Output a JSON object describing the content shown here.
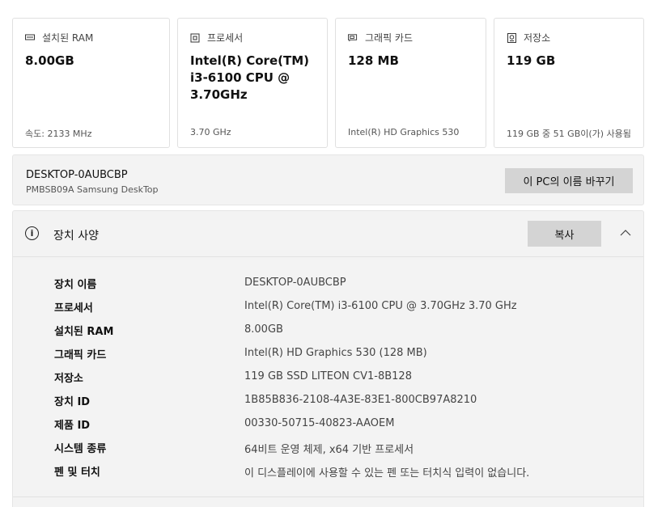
{
  "cards": [
    {
      "icon": "memory-icon",
      "title": "설치된 RAM",
      "value": "8.00GB",
      "footer": "속도: 2133 MHz"
    },
    {
      "icon": "processor-icon",
      "title": "프로세서",
      "value": "Intel(R) Core(TM) i3-6100 CPU @ 3.70GHz",
      "footer": "3.70 GHz"
    },
    {
      "icon": "graphics-card-icon",
      "title": "그래픽 카드",
      "value": "128 MB",
      "footer": "Intel(R) HD Graphics 530"
    },
    {
      "icon": "storage-icon",
      "title": "저장소",
      "value": "119 GB",
      "footer": "119 GB 중 51 GB이(가) 사용됨"
    }
  ],
  "device": {
    "name": "DESKTOP-0AUBCBP",
    "model": "PMBSB09A Samsung DeskTop",
    "rename_label": "이 PC의 이름 바꾸기"
  },
  "specs": {
    "title": "장치 사양",
    "copy_label": "복사",
    "rows": [
      {
        "label": "장치 이름",
        "value": "DESKTOP-0AUBCBP"
      },
      {
        "label": "프로세서",
        "value": "Intel(R) Core(TM) i3-6100 CPU @ 3.70GHz   3.70 GHz"
      },
      {
        "label": "설치된 RAM",
        "value": "8.00GB"
      },
      {
        "label": "그래픽 카드",
        "value": "Intel(R) HD Graphics 530 (128 MB)"
      },
      {
        "label": "저장소",
        "value": "119 GB SSD LITEON CV1-8B128"
      },
      {
        "label": "장치 ID",
        "value": "1B85B836-2108-4A3E-83E1-800CB97A8210"
      },
      {
        "label": "제품 ID",
        "value": "00330-50715-40823-AAOEM"
      },
      {
        "label": "시스템 종류",
        "value": "64비트 운영 체제, x64 기반 프로세서"
      },
      {
        "label": "펜 및 터치",
        "value": "이 디스플레이에 사용할 수 있는 펜 또는 터치식 입력이 없습니다."
      }
    ]
  }
}
